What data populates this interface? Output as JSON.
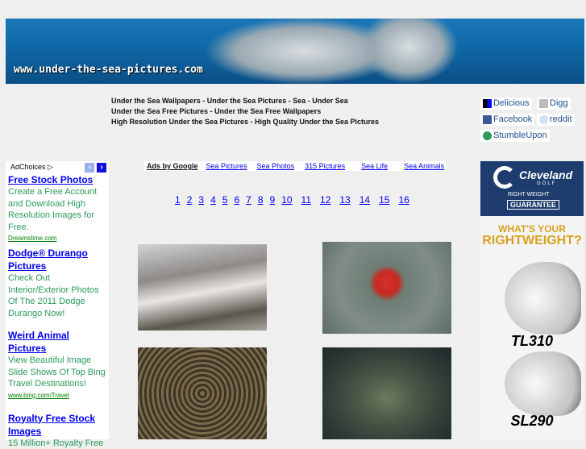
{
  "banner": {
    "url": "www.under-the-sea-pictures.com"
  },
  "taglines": [
    "Under the Sea Wallpapers - Under the Sea Pictures - Sea - Under Sea",
    "Under the Sea Free Pictures - Under the Sea Free Wallpapers",
    "High Resolution Under the Sea Pictures - High Quality Under the Sea Pictures"
  ],
  "social": [
    {
      "label": "Delicious",
      "icon": "delicious-icon"
    },
    {
      "label": "Digg",
      "icon": "digg-icon"
    },
    {
      "label": "Facebook",
      "icon": "facebook-icon"
    },
    {
      "label": "reddit",
      "icon": "reddit-icon"
    },
    {
      "label": "StumbleUpon",
      "icon": "stumbleupon-icon"
    }
  ],
  "left_ad": {
    "adchoices": "AdChoices ▷",
    "ads": [
      {
        "title": "Free Stock Photos",
        "desc": "Create a Free Account and Download High Resolution Images for Free.",
        "url": "Dreamstime.com"
      },
      {
        "title": "Dodge® Durango Pictures",
        "desc": "Check Out Interior/Exterior Photos Of The 2011 Dodge Durango Now!",
        "url": ""
      },
      {
        "title": "Weird Animal Pictures",
        "desc": "View Beautiful Image Slide Shows Of Top Bing Travel Destinations!",
        "url": "www.bing.com/Travel"
      },
      {
        "title": "Royalty Free Stock Images",
        "desc": "15 Million+ Royalty Free",
        "url": ""
      }
    ]
  },
  "linkbar": {
    "label": "Ads by Google",
    "links": [
      "Sea Pictures",
      "Sea Photos",
      "315 Pictures",
      "Sea Life",
      "Sea Animals"
    ]
  },
  "pages": [
    "1",
    "2",
    "3",
    "4",
    "5",
    "6",
    "7",
    "8",
    "9",
    "10",
    "11",
    "12",
    "13",
    "14",
    "15",
    "16"
  ],
  "right_ad": {
    "brand": "Cleveland",
    "sub": "GOLF",
    "badge1": "RIGHT WEIGHT",
    "badge2": "GUARANTEE",
    "headline1": "WHAT'S YOUR",
    "headline2": "RIGHTWEIGHT?",
    "model1": "TL310",
    "model2": "SL290",
    "colors": {
      "navy": "#1e3d6e",
      "gold": "#d9a21f"
    }
  }
}
